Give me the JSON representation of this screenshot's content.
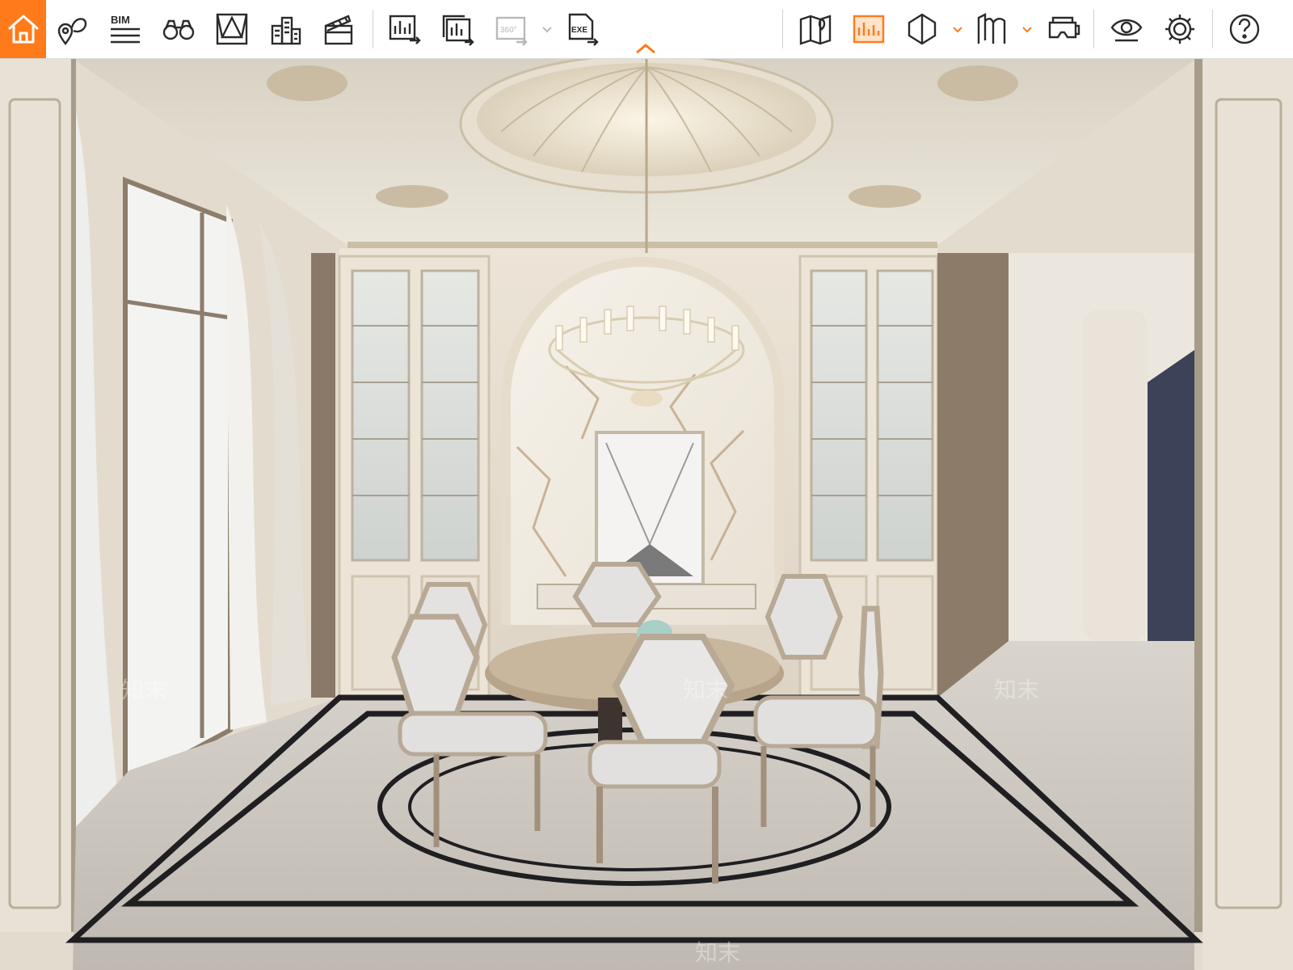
{
  "toolbar": {
    "buttons": [
      {
        "name": "home",
        "icon": "home-icon",
        "active": true
      },
      {
        "name": "map-pin",
        "icon": "map-pin-icon"
      },
      {
        "name": "bim",
        "icon": "bim-icon",
        "label": "BIM"
      },
      {
        "name": "binoculars",
        "icon": "binoculars-icon"
      },
      {
        "name": "perspective",
        "icon": "perspective-icon"
      },
      {
        "name": "buildings",
        "icon": "buildings-icon"
      },
      {
        "name": "clapper",
        "icon": "clapper-icon"
      },
      {
        "name": "export-image",
        "icon": "export-image-icon"
      },
      {
        "name": "export-batch",
        "icon": "export-batch-icon"
      },
      {
        "name": "export-360",
        "icon": "export-360-icon",
        "label": "360°",
        "disabled": true
      },
      {
        "name": "export-exe",
        "icon": "export-exe-icon",
        "label": "EXE"
      },
      {
        "name": "floor-map",
        "icon": "floor-map-icon"
      },
      {
        "name": "screen",
        "icon": "screen-icon",
        "active": true
      },
      {
        "name": "section",
        "icon": "section-icon"
      },
      {
        "name": "walls",
        "icon": "walls-icon"
      },
      {
        "name": "vr",
        "icon": "vr-icon"
      },
      {
        "name": "view",
        "icon": "eye-icon"
      },
      {
        "name": "settings",
        "icon": "gear-icon"
      },
      {
        "name": "help",
        "icon": "help-icon"
      }
    ],
    "accent": "#ff7a1a",
    "icon_color": "#2a2a2a"
  },
  "scene": {
    "watermark": "知末"
  }
}
